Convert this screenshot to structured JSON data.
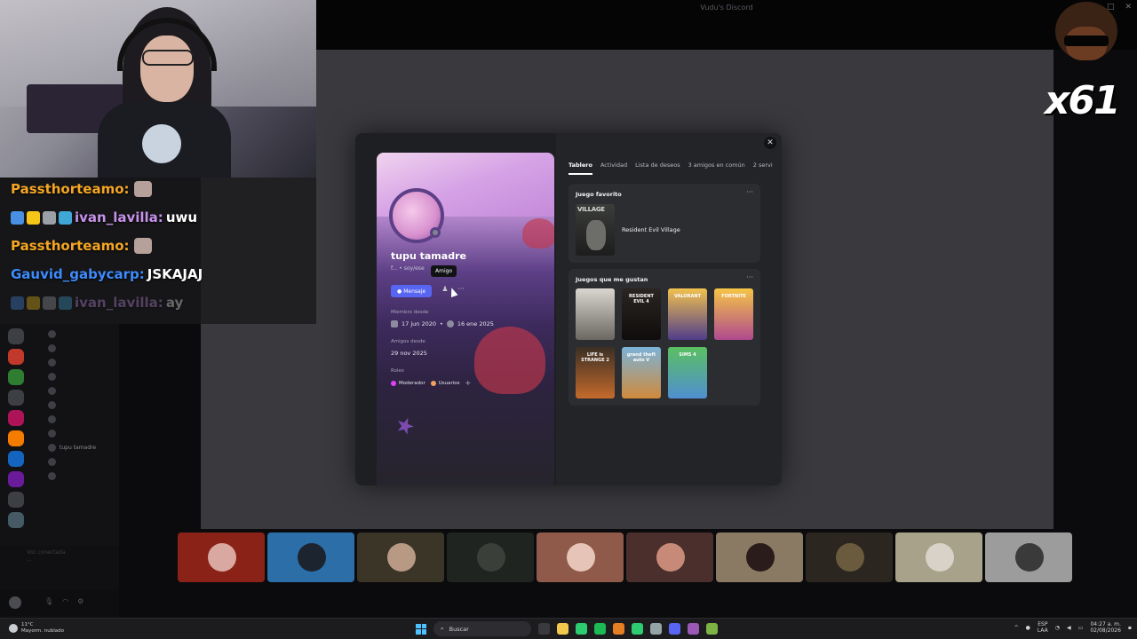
{
  "window": {
    "title": "Vudu's Discord"
  },
  "stream_chat": [
    {
      "user": "Passthorteamo:",
      "message": "",
      "user_color": "#f5a623",
      "emote": true,
      "faded": false,
      "badges": []
    },
    {
      "user": "ivan_lavilla:",
      "message": "uwu",
      "user_color": "#c792ea",
      "emote": false,
      "faded": false,
      "badges": [
        "#4a90e2",
        "#f5c518",
        "#9aa0a6",
        "#3fa7d6"
      ]
    },
    {
      "user": "Passthorteamo:",
      "message": "",
      "user_color": "#f5a623",
      "emote": true,
      "faded": false,
      "badges": []
    },
    {
      "user": "Gauvid_gabycarp:",
      "message": "JSKAJAJ",
      "user_color": "#3d8bfd",
      "emote": false,
      "faded": false,
      "badges": []
    },
    {
      "user": "ivan_lavilla:",
      "message": "ay",
      "user_color": "#c792ea",
      "emote": false,
      "faded": true,
      "badges": [
        "#4a90e2",
        "#f5c518",
        "#9aa0a6",
        "#3fa7d6"
      ]
    }
  ],
  "overlay": {
    "counter": "x61"
  },
  "sidebar": {
    "members": [
      {
        "name": "",
        "highlight": false
      },
      {
        "name": "",
        "highlight": false
      },
      {
        "name": "",
        "highlight": false
      },
      {
        "name": "",
        "highlight": false
      },
      {
        "name": "",
        "highlight": false
      },
      {
        "name": "",
        "highlight": false
      },
      {
        "name": "",
        "highlight": false
      },
      {
        "name": "",
        "highlight": false
      },
      {
        "name": "tupu tamadre",
        "highlight": true
      },
      {
        "name": "",
        "highlight": false
      },
      {
        "name": "",
        "highlight": false
      }
    ],
    "servers": [
      "#3d3f45",
      "#c0392b",
      "#2e7d32",
      "#3d3f45",
      "#ad1457",
      "#f57c00",
      "#1565c0",
      "#6a1b9a",
      "#3d3f45",
      "#455a64"
    ]
  },
  "profile": {
    "display_name": "tupu tamadre",
    "handle": "f... • soy/ese",
    "tooltip": "Amigo",
    "message_button": "Mensaje",
    "friend_icon": "friend-icon",
    "more_icon": "more-icon",
    "member_since_label": "Miembro desde",
    "member_since_discord": "17 jun 2020",
    "member_since_server": "16 ene 2025",
    "friends_since_label": "Amigos desde",
    "friends_since": "29 nov 2025",
    "roles_label": "Roles",
    "roles": [
      {
        "name": "Moderador",
        "color": "#e040fb"
      },
      {
        "name": "Usuarios",
        "color": "#f0a060"
      }
    ],
    "add_role": "+"
  },
  "tabs": [
    {
      "label": "Tablero",
      "active": true
    },
    {
      "label": "Actividad",
      "active": false
    },
    {
      "label": "Lista de deseos",
      "active": false
    },
    {
      "label": "3 amigos en común",
      "active": false
    },
    {
      "label": "2 servi",
      "active": false
    }
  ],
  "favorite_game": {
    "title": "Juego favorito",
    "name": "Resident Evil Village",
    "cover_text": "VILLAGE"
  },
  "liked_games": {
    "title": "Juegos que me gustan",
    "games": [
      {
        "label": "",
        "color1": "#d9d6cf",
        "color2": "#6b6862"
      },
      {
        "label": "RESIDENT EVIL 4",
        "color1": "#2a2522",
        "color2": "#0f0d0c"
      },
      {
        "label": "VALORANT",
        "color1": "#f2c14e",
        "color2": "#4f3d8a"
      },
      {
        "label": "FORTNITE",
        "color1": "#f6c545",
        "color2": "#b04a8f"
      },
      {
        "label": "LIFE is STRANGE 2",
        "color1": "#3a2f24",
        "color2": "#c56a2c"
      },
      {
        "label": "grand theft auto V",
        "color1": "#7bb3d8",
        "color2": "#d08a3c"
      },
      {
        "label": "SIMS 4",
        "color1": "#5bbf61",
        "color2": "#4f8fd1"
      }
    ]
  },
  "participants": [
    {
      "bg": "#8a2218",
      "blob": "#d9a8a0"
    },
    {
      "bg": "#2b6ea8",
      "blob": "#1c2430"
    },
    {
      "bg": "#3b3528",
      "blob": "#b89a84"
    },
    {
      "bg": "#1f2420",
      "blob": "#3a3f3a"
    },
    {
      "bg": "#8f5a4a",
      "blob": "#e7c4b8"
    },
    {
      "bg": "#4a2f2c",
      "blob": "#c88a78"
    },
    {
      "bg": "#8a7a64",
      "blob": "#2a1c1a"
    },
    {
      "bg": "#2b2620",
      "blob": "#6b5b3e"
    },
    {
      "bg": "#a8a28a",
      "blob": "#d8d2c8"
    },
    {
      "bg": "#9c9c9c",
      "blob": "#3a3a3a"
    }
  ],
  "voice": {
    "status": "Voz conectada",
    "channel": "...",
    "icons": [
      "mic-icon",
      "headphones-icon",
      "gear-icon"
    ]
  },
  "taskbar": {
    "weather_temp": "11°C",
    "weather_desc": "Mayorm. nublado",
    "search_placeholder": "Buscar",
    "lang_top": "ESP",
    "lang_bottom": "LAA",
    "time": "04:27 a. m.",
    "date": "02/08/2026",
    "apps": [
      "#3a3a3e",
      "#f2c94c",
      "#2ecc71",
      "#1db954",
      "#e67e22",
      "#2ecc71",
      "#95a5a6",
      "#5865f2",
      "#9b59b6",
      "#7cb342"
    ]
  }
}
